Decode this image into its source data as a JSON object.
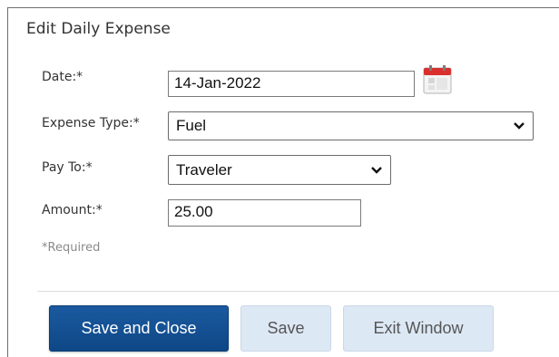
{
  "dialog": {
    "title": "Edit Daily Expense"
  },
  "form": {
    "date": {
      "label": "Date:*",
      "value": "14-Jan-2022"
    },
    "expense_type": {
      "label": "Expense Type:*",
      "selected": "Fuel"
    },
    "pay_to": {
      "label": "Pay To:*",
      "selected": "Traveler"
    },
    "amount": {
      "label": "Amount:*",
      "value": "25.00"
    },
    "required_note": "*Required"
  },
  "buttons": {
    "save_and_close": "Save and Close",
    "save": "Save",
    "exit_window": "Exit Window"
  },
  "icons": {
    "calendar": "calendar-icon",
    "dropdown": "chevron-down-icon"
  },
  "colors": {
    "primary_button": "#1b5aa0",
    "secondary_button": "#dde8f5",
    "calendar_red": "#d9302f"
  }
}
